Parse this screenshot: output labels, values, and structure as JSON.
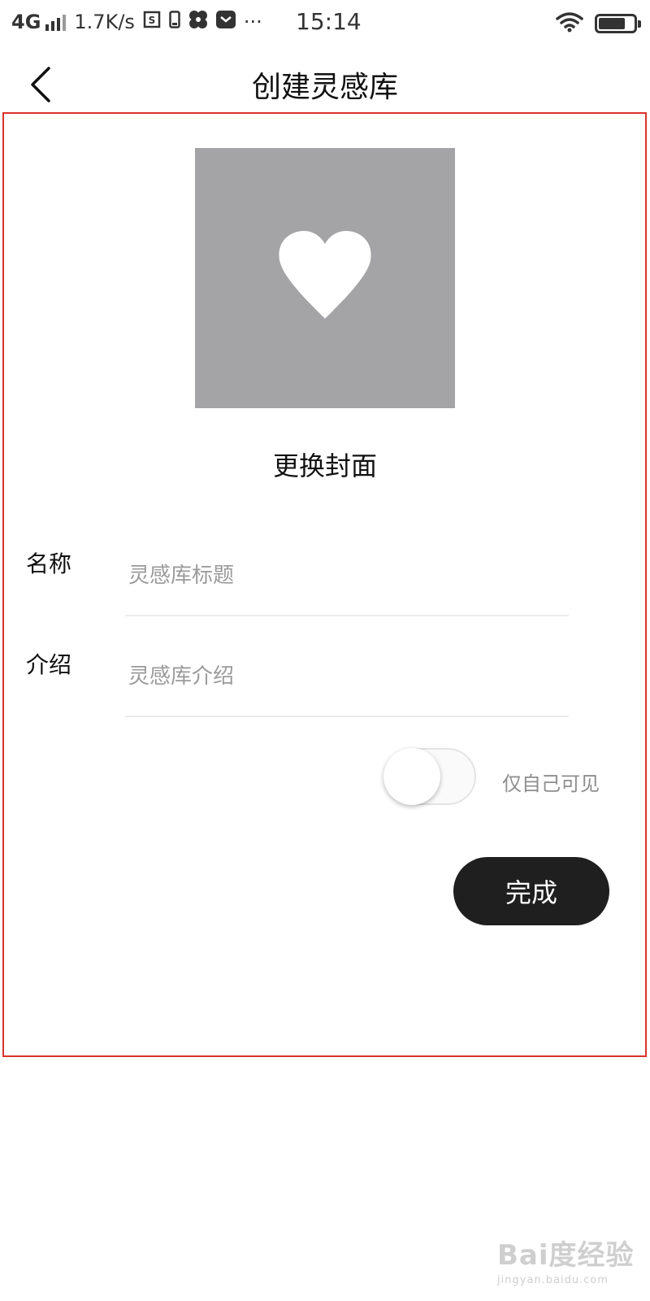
{
  "status_bar": {
    "network": "4G",
    "speed": "1.7K/s",
    "more": "···",
    "time": "15:14",
    "icons": [
      "signal-icon",
      "screenshot-icon",
      "phone-icon",
      "pinwheel-icon",
      "mail-icon",
      "wifi-icon",
      "battery-icon"
    ]
  },
  "header": {
    "title": "创建灵感库",
    "back_icon": "chevron-left-icon"
  },
  "cover": {
    "icon": "heart-icon",
    "background": "#a4a4a6",
    "change_label": "更换封面"
  },
  "form": {
    "name_label": "名称",
    "name_placeholder": "灵感库标题",
    "name_value": "",
    "intro_label": "介绍",
    "intro_placeholder": "灵感库介绍",
    "intro_value": ""
  },
  "privacy": {
    "label": "仅自己可见",
    "enabled": false
  },
  "actions": {
    "done_label": "完成"
  },
  "colors": {
    "highlight_frame": "#d9332b",
    "button_bg": "#1f1f1f",
    "cover_bg": "#a4a4a6"
  },
  "watermark": {
    "logo": "Bai度经验",
    "url": "jingyan.baidu.com"
  }
}
